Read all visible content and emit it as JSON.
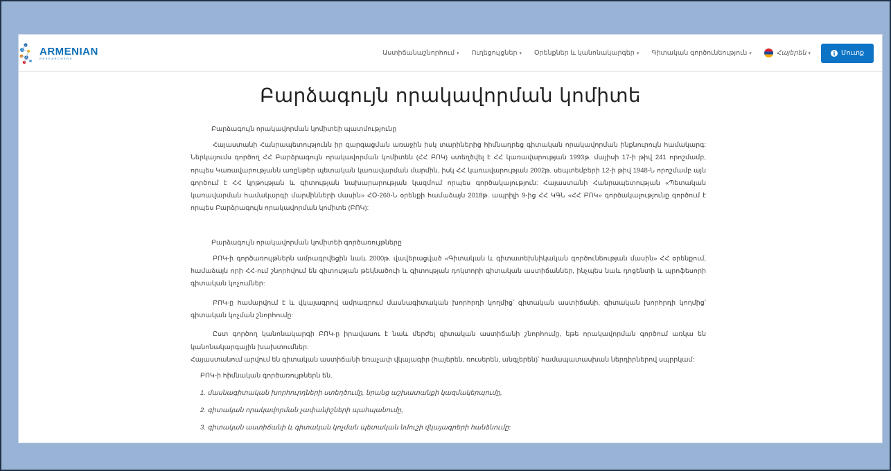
{
  "brand": {
    "name": "ARMENIAN",
    "sub": "RESEARCHERS"
  },
  "nav": {
    "items": [
      {
        "label": "Աստիճանաշնորհում"
      },
      {
        "label": "Ուղեցույցներ"
      },
      {
        "label": "Օրենքներ և կանոնակարգեր"
      },
      {
        "label": "Գիտական գործունեություն"
      }
    ],
    "language": "Հայերեն",
    "login": "Մուտք"
  },
  "page": {
    "title": "Բարձագույն որակավորման կոմիտե",
    "section1_title": "Բարձագույն որակավորման կոմիտեի պատմությունը",
    "section1_paragraph": "Հայաստանի Հանրապետությունն իր զարգացման առաջին իսկ տարիներից հիմնադրեց գիտական որակավորման ինքնուրույն համակարգ: Ներկայումս գործող ՀՀ Բարձրագույն որակավորման կոմիտեն (ՀՀ ԲՈԿ) ստեղծվել է ՀՀ կառավարության 1993թ. մայիսի 17-ի թիվ 241 որոշմամբ, որպես Կառավարությանն առընթեր պետական կառավարման մարմին, իսկ ՀՀ կառավարության 2002թ. սեպտեմբերի 12-ի թիվ 1948-Ն որոշմամբ այն գործում է ՀՀ կրթության և գիտության նախարարության կազմում որպես գործակալություն: Հայաստանի Հանրապետության «Պետական կառավարման համակարգի մարմինների մասին» ՀՕ-260-Ն օրենքի համաձայն 2018թ. ապրիլի 9-ից ՀՀ ԿԳՆ «ՀՀ ԲՈԿ» գործակալությունը գործում է որպես Բարձրագույն որակավորման կոմիտե (ԲՈԿ):",
    "section2_title": "Բարձագույն որակավորման կոմիտեի գործառույթները",
    "section2_paragraph1": "ԲՈԿ-ի գործառույթներն ամրագրվեցին նաև 2000թ. վավերացված «Գիտական և գիտատեխնիկական գործունեության մասին» ՀՀ օրենքում, համաձայն որի ՀՀ-ում շնորհվում են գիտության թեկնածուի և գիտության դոկտորի գիտական աստիճաններ, ինչպես նաև դոցենտի և պրոֆեսորի գիտական կոչումներ:",
    "section2_paragraph2": "ԲՈԿ-ը համարվում է և վկայագրով ամրագրում մասնագիտական խորհրդի կողմից՝ գիտական աստիճանի, գիտական խորհրդի կողմից՝ գիտական կոչման շնորհումը:",
    "section2_paragraph3": "Ըստ գործող կանոնակարգի ԲՈԿ-ը իրավասու է նաև մերժել գիտական աստիճանի շնորհումը, եթե որակավորման գործում առկա են կանոնակարգային խախտումներ:",
    "section2_line": "Հայաստանում արվում են գիտական աստիճանի եռաչափ վկայագիր (հայերեն, ռուսերեն, անգլերեն)՝ համապատասխան ներդիրներով սպրրկամ:",
    "functions_heading": "ԲՈԿ-ի հիմնական գործառույթներն են.",
    "functions": [
      "1. մասնագիտական խորհուրդների ստեղծումը, նրանց աշխատանքի կազմակերպումը,",
      "2. գիտական որակավորման չափանիշների պահպանումը,",
      "3. գիտական աստիճանի և գիտական կոչման պետական նմուշի վկայագրերի հանձնումը:"
    ]
  },
  "colors": {
    "frame_bg": "#98b3d6",
    "accent": "#0d73c5"
  }
}
